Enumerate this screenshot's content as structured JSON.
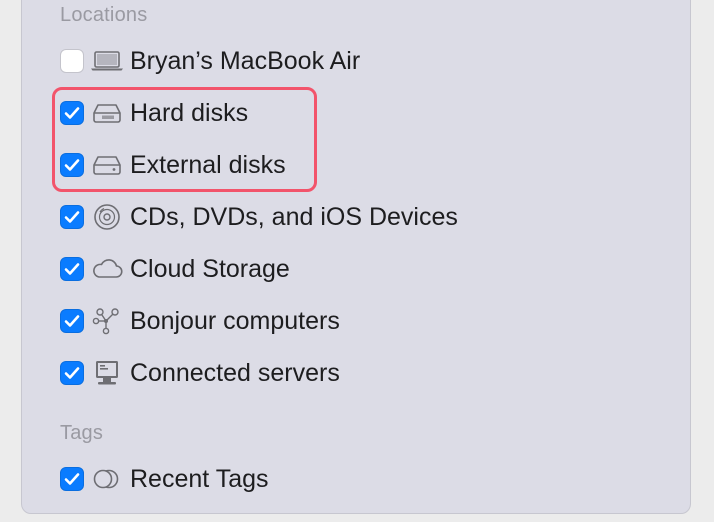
{
  "sections": {
    "locations": "Locations",
    "tags": "Tags"
  },
  "items": [
    {
      "label": "Bryan’s MacBook Air",
      "checked": false,
      "icon": "laptop-icon"
    },
    {
      "label": "Hard disks",
      "checked": true,
      "icon": "internal-disk-icon"
    },
    {
      "label": "External disks",
      "checked": true,
      "icon": "external-disk-icon"
    },
    {
      "label": "CDs, DVDs, and iOS Devices",
      "checked": true,
      "icon": "disc-icon"
    },
    {
      "label": "Cloud Storage",
      "checked": true,
      "icon": "cloud-icon"
    },
    {
      "label": "Bonjour computers",
      "checked": true,
      "icon": "bonjour-icon"
    },
    {
      "label": "Connected servers",
      "checked": true,
      "icon": "server-icon"
    }
  ],
  "tags_items": [
    {
      "label": "Recent Tags",
      "checked": true,
      "icon": "tags-icon"
    }
  ],
  "colors": {
    "accent": "#0a7cff",
    "highlight": "#f2546b"
  }
}
